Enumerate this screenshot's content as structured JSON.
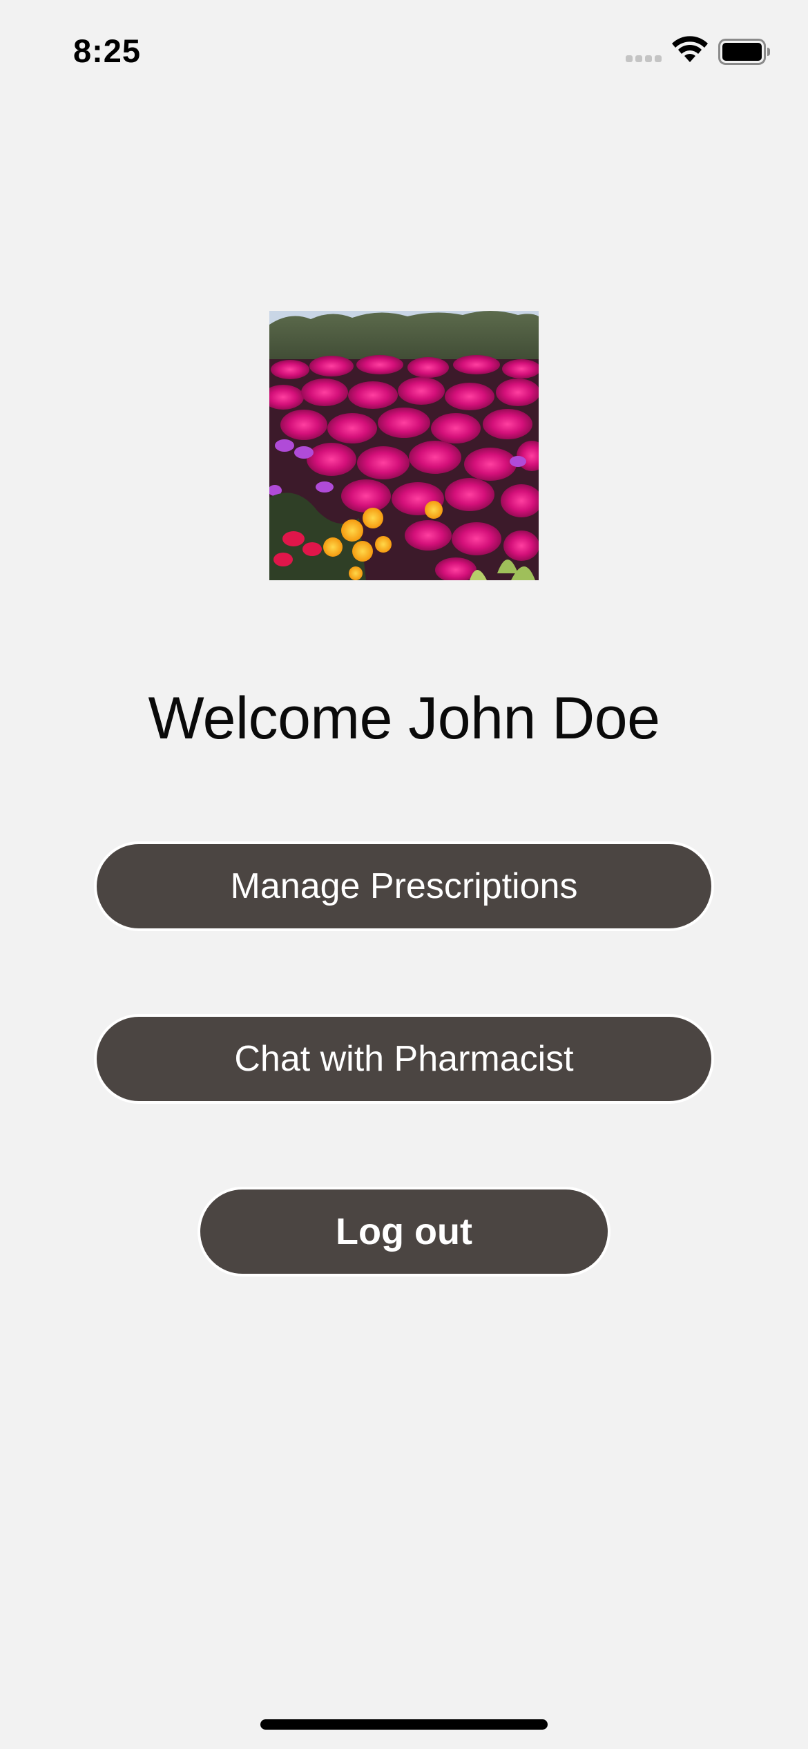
{
  "status_bar": {
    "time": "8:25",
    "icons": [
      "signal-icon",
      "wifi-icon",
      "battery-icon"
    ]
  },
  "hero_image": {
    "icon": "flower-photo"
  },
  "welcome": {
    "title": "Welcome John Doe"
  },
  "actions": {
    "manage_prescriptions_label": "Manage Prescriptions",
    "chat_pharmacist_label": "Chat with Pharmacist",
    "logout_label": "Log out"
  },
  "colors": {
    "background": "#f2f2f2",
    "button_fill": "#4b4542",
    "button_border": "#ffffff",
    "button_text": "#ffffff",
    "title_text": "#0a0a0a"
  }
}
